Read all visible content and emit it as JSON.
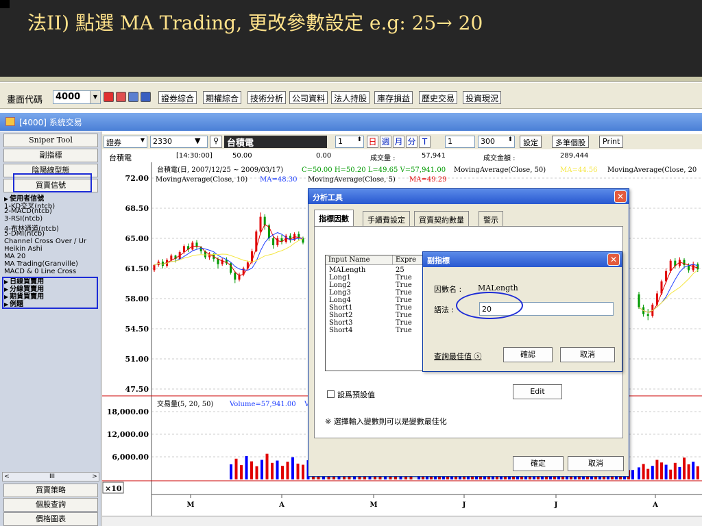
{
  "slide": {
    "title": "法II) 點選 MA Trading, 更改參數設定 e.g: 25→ 20"
  },
  "toolbar": {
    "code_label": "畫面代碼",
    "code_value": "4000",
    "buttons": [
      "證券綜合",
      "期權綜合",
      "技術分析",
      "公司資料",
      "法人持股",
      "庫存損益",
      "歷史交易",
      "投資現況"
    ]
  },
  "window": {
    "title": "[4000] 系統交易"
  },
  "left_panel": {
    "top_buttons": [
      "Sniper Tool",
      "副指標",
      "陰陽線型態",
      "買賣信號"
    ],
    "tree": [
      {
        "label": "使用者信號",
        "bold": true,
        "marker": "▶"
      },
      {
        "label": "1-KD交叉(ntcb)"
      },
      {
        "label": "2-MACD(ntcb)"
      },
      {
        "label": "3-RSI(ntcb)"
      },
      {
        "label": "4-布林通道(ntcb)"
      },
      {
        "label": "5-DMI(ntcb)"
      },
      {
        "label": "Channel Cross Over / Ur"
      },
      {
        "label": "Heikin Ashi"
      },
      {
        "label": "MA 20"
      },
      {
        "label": "MA Trading(Granville)"
      },
      {
        "label": "MACD & 0 Line Cross"
      },
      {
        "label": "日線買賣用",
        "bold": true,
        "marker": "▶"
      },
      {
        "label": "分線買賣用",
        "bold": true,
        "marker": "▶"
      },
      {
        "label": "期貨買賣用",
        "bold": true,
        "marker": "▶"
      },
      {
        "label": "例題",
        "bold": true,
        "marker": "▶"
      }
    ],
    "scroll_left": "<",
    "scroll_mid": "III",
    "scroll_right": ">",
    "bottom_buttons": [
      "買賣策略",
      "個股查詢",
      "價格圖表"
    ]
  },
  "chart_bar": {
    "market": "證券",
    "symbol": "2330",
    "name": "台積電",
    "count": "1",
    "periods": [
      "日",
      "週",
      "月",
      "分",
      "T"
    ],
    "period_num": "1",
    "bars": "300",
    "set_label": "設定",
    "multi_label": "多筆個股",
    "print_label": "Print"
  },
  "info_row": {
    "name": "台積電",
    "time": "[14:30:00]",
    "price": "50.00",
    "change": "0.00",
    "volume_label": "成交量 :",
    "volume": "57,941",
    "amount_label": "成交金額 :",
    "amount": "289,444"
  },
  "chart_labels": {
    "header": "台積電(日, 2007/12/25 ~ 2009/03/17)",
    "ohlc": "C=50.00 H=50.20 L=49.65 V=57,941.00",
    "ma50": "MovingAverage(Close, 50)",
    "ma50_val": "MA=44.56",
    "ma20": "MovingAverage(Close, 20",
    "ma10": "MovingAverage(Close, 10)",
    "ma10_val": "MA=48.30",
    "ma5": "MovingAverage(Close, 5)",
    "ma5_val": "MA=49.29",
    "vol_header": "交易量(5, 20, 50)",
    "vol_val": "Volume=57,941.00",
    "vol_tail": "V",
    "multiplier": "×10",
    "months": [
      "M",
      "A",
      "M",
      "J",
      "J",
      "A"
    ]
  },
  "colors": {
    "ma5": "#e00000",
    "ma10": "#2040ff",
    "ma20": "#6080e0",
    "ma50": "#f5e642",
    "up": "#e00000",
    "down": "#0000ff",
    "green": "#009900",
    "highlight": "#1c2bd6"
  },
  "chart_data": {
    "type": "candlestick",
    "price_axis": {
      "ticks": [
        "72.00",
        "68.50",
        "65.00",
        "61.50",
        "58.00",
        "54.50",
        "51.00",
        "47.50"
      ],
      "range": [
        47.5,
        72.0
      ]
    },
    "volume_axis": {
      "ticks": [
        "18,000.00",
        "12,000.00",
        "6,000.00"
      ],
      "range": [
        0,
        18000
      ]
    },
    "candles": [
      [
        61.3,
        61.9,
        62.0,
        61.1
      ],
      [
        61.9,
        62.3,
        62.5,
        61.7
      ],
      [
        62.3,
        61.8,
        62.6,
        61.5
      ],
      [
        61.8,
        62.5,
        62.7,
        61.6
      ],
      [
        62.5,
        63.0,
        63.2,
        62.3
      ],
      [
        63.0,
        62.6,
        63.1,
        62.2
      ],
      [
        62.6,
        63.4,
        63.6,
        62.5
      ],
      [
        63.4,
        64.1,
        64.3,
        63.2
      ],
      [
        64.1,
        63.7,
        64.4,
        63.4
      ],
      [
        63.7,
        64.5,
        64.7,
        63.6
      ],
      [
        64.5,
        64.0,
        64.8,
        63.8
      ],
      [
        64.0,
        63.5,
        64.1,
        63.2
      ],
      [
        63.5,
        62.8,
        63.6,
        62.6
      ],
      [
        62.8,
        63.2,
        63.4,
        62.5
      ],
      [
        63.2,
        62.6,
        63.3,
        62.3
      ],
      [
        62.6,
        62.0,
        62.8,
        61.5
      ],
      [
        62.0,
        62.5,
        62.7,
        61.8
      ],
      [
        62.5,
        62.1,
        62.8,
        61.9
      ],
      [
        62.1,
        61.0,
        62.2,
        60.8
      ],
      [
        61.0,
        60.2,
        61.2,
        59.8
      ],
      [
        60.2,
        60.8,
        61.0,
        60.0
      ],
      [
        60.8,
        61.5,
        61.7,
        60.6
      ],
      [
        61.5,
        62.2,
        62.4,
        61.4
      ],
      [
        62.2,
        63.5,
        63.8,
        62.0
      ],
      [
        63.5,
        65.8,
        66.0,
        63.4
      ],
      [
        65.8,
        67.5,
        68.0,
        65.5
      ],
      [
        67.5,
        66.5,
        67.8,
        66.0
      ],
      [
        66.5,
        65.0,
        66.7,
        64.7
      ],
      [
        65.0,
        64.2,
        65.2,
        63.8
      ],
      [
        64.2,
        65.0,
        65.3,
        64.0
      ],
      [
        65.0,
        64.6,
        65.4,
        64.3
      ],
      [
        64.6,
        65.3,
        65.5,
        64.4
      ],
      [
        65.3,
        64.8,
        65.6,
        64.5
      ],
      [
        64.8,
        65.5,
        65.7,
        64.7
      ],
      [
        65.5,
        65.0,
        65.8,
        64.8
      ],
      [
        65.0,
        64.5,
        65.2,
        64.3
      ]
    ],
    "candles_right": [
      [
        58.5,
        57.0,
        58.8,
        56.8
      ],
      [
        57.0,
        56.2,
        57.3,
        55.9
      ],
      [
        56.2,
        56.0,
        56.8,
        55.5
      ],
      [
        56.0,
        57.3,
        57.5,
        55.8
      ],
      [
        57.3,
        58.6,
        58.9,
        57.1
      ],
      [
        58.6,
        60.0,
        60.2,
        58.4
      ],
      [
        60.0,
        61.2,
        61.5,
        59.8
      ],
      [
        61.2,
        62.4,
        62.6,
        61.0
      ],
      [
        62.4,
        61.8,
        62.7,
        61.5
      ],
      [
        61.8,
        62.5,
        62.8,
        61.6
      ],
      [
        62.5,
        61.9,
        62.7,
        61.5
      ],
      [
        61.9,
        61.3,
        62.1,
        61.0
      ],
      [
        61.3,
        62.0,
        62.3,
        61.1
      ],
      [
        62.0,
        61.4,
        62.2,
        61.1
      ]
    ],
    "volumes": [
      4000,
      5500,
      3800,
      6200,
      4800,
      3500,
      5200,
      6800,
      4400,
      5000,
      3600,
      4700,
      5900,
      4200,
      3900,
      5100,
      4600,
      6400,
      7500,
      5300,
      4100,
      6000,
      8800,
      11200,
      13200,
      9800,
      7600,
      5400,
      4800,
      6900,
      4300,
      5700,
      3800,
      4900,
      3600,
      4200
    ],
    "volumes_right": [
      3200,
      4100,
      2800,
      3600,
      5200,
      4500,
      3900,
      2600,
      4400,
      3300,
      5800,
      4000,
      4700,
      3500
    ]
  },
  "dialog": {
    "title": "分析工具",
    "tabs": [
      "指標因數",
      "手續費設定",
      "買賣契約數量",
      "警示"
    ],
    "table_headers": [
      "Input Name",
      "Expre"
    ],
    "table_rows": [
      [
        "MALength",
        "25"
      ],
      [
        "Long1",
        "True"
      ],
      [
        "Long2",
        "True"
      ],
      [
        "Long3",
        "True"
      ],
      [
        "Long4",
        "True"
      ],
      [
        "Short1",
        "True"
      ],
      [
        "Short2",
        "True"
      ],
      [
        "Short3",
        "True"
      ],
      [
        "Short4",
        "True"
      ]
    ],
    "default_label": "設爲預設值",
    "edit_label": "Edit",
    "note": "※ 選擇輸入變數則可以是變數最佳化",
    "ok_label": "確定",
    "cancel_label": "取消",
    "close": "✕"
  },
  "subdialog": {
    "title": "副指標",
    "factor_label": "因數名 :",
    "factor_value": "MALength",
    "syntax_label": "語法 :",
    "syntax_value": "20",
    "optimize_label": "查詢最佳值 ⓢ",
    "confirm_label": "確認",
    "cancel_label": "取消",
    "close": "✕"
  }
}
